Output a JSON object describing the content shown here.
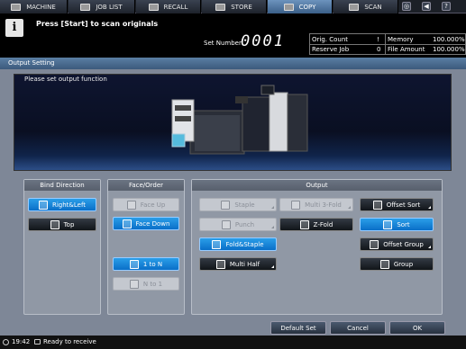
{
  "tabs": [
    {
      "label": "MACHINE",
      "icon": "machine-icon"
    },
    {
      "label": "JOB LIST",
      "icon": "job-list-icon"
    },
    {
      "label": "RECALL",
      "icon": "recall-icon"
    },
    {
      "label": "STORE",
      "icon": "store-icon"
    },
    {
      "label": "COPY",
      "icon": "copy-icon"
    },
    {
      "label": "SCAN",
      "icon": "scan-icon"
    }
  ],
  "active_tab": "COPY",
  "message": "Press [Start] to scan originals",
  "set_number_label": "Set Number",
  "set_number": "0001",
  "status_table": {
    "orig_count_label": "Orig. Count",
    "orig_count": "!",
    "memory_label": "Memory",
    "memory": "100.000%",
    "reserve_job_label": "Reserve Job",
    "reserve_job": "0",
    "file_amount_label": "File Amount",
    "file_amount": "100.000%"
  },
  "screen_title": "Output Setting",
  "preview_text": "Please set output function",
  "bind_direction": {
    "title": "Bind Direction",
    "right_left": "Right&Left",
    "top": "Top"
  },
  "face_order": {
    "title": "Face/Order",
    "face_up": "Face Up",
    "face_down": "Face Down",
    "one_to_n": "1 to N",
    "n_to_one": "N to 1"
  },
  "output": {
    "title": "Output",
    "staple": "Staple",
    "punch": "Punch",
    "fold_staple": "Fold&Staple",
    "multi_half": "Multi Half",
    "multi_3fold": "Multi 3-Fold",
    "z_fold": "Z-Fold",
    "offset_sort": "Offset Sort",
    "sort": "Sort",
    "offset_group": "Offset Group",
    "group": "Group"
  },
  "buttons": {
    "default_set": "Default Set",
    "cancel": "Cancel",
    "ok": "OK"
  },
  "status_line": {
    "time": "19:42",
    "text": "Ready to receive"
  },
  "colors": {
    "selected": "#1a8ee0",
    "active_tab": "#5a82ad",
    "panel_bg": "#9098a5"
  }
}
